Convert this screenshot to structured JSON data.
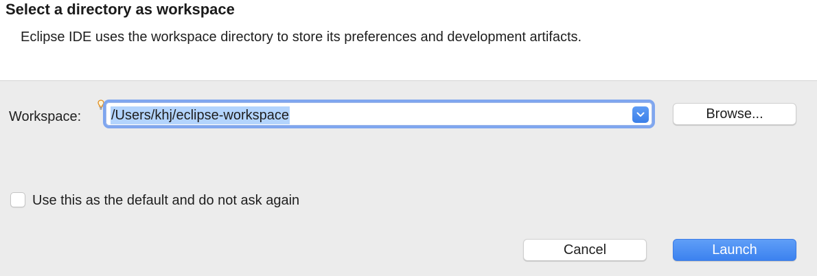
{
  "header": {
    "title": "Select a directory as workspace",
    "description": "Eclipse IDE uses the workspace directory to store its preferences and development artifacts."
  },
  "workspace": {
    "label": "Workspace:",
    "value": "/Users/khj/eclipse-workspace",
    "hint_icon": "content-assist-bulb-icon",
    "dropdown_icon": "chevron-down-icon"
  },
  "buttons": {
    "browse": "Browse...",
    "cancel": "Cancel",
    "launch": "Launch"
  },
  "default_option": {
    "label": "Use this as the default and do not ask again",
    "checked": false
  },
  "colors": {
    "accent": "#3c82ef",
    "selection": "#b3d4fd",
    "focus_ring": "#7fa6ef"
  }
}
